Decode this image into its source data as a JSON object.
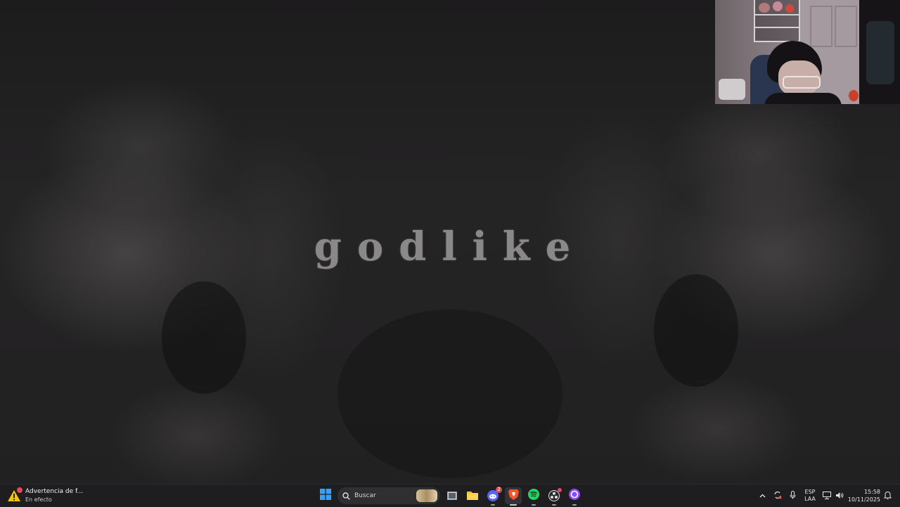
{
  "wallpaper": {
    "title": "godlike"
  },
  "taskbar": {
    "notification": {
      "title": "Advertencia de f...",
      "subtitle": "En efecto",
      "icon": "warning-icon",
      "badge_color": "#e74856"
    },
    "search": {
      "placeholder": "Buscar",
      "icon": "search-icon"
    },
    "apps": [
      {
        "name": "start-button",
        "icon": "windows-icon"
      },
      {
        "name": "task-view",
        "icon": "task-view-icon"
      },
      {
        "name": "file-explorer",
        "icon": "folder-icon"
      },
      {
        "name": "discord",
        "icon": "discord-icon",
        "badge": "2"
      },
      {
        "name": "brave",
        "icon": "brave-icon"
      },
      {
        "name": "spotify",
        "icon": "spotify-icon"
      },
      {
        "name": "obs",
        "icon": "obs-icon"
      },
      {
        "name": "app-purple",
        "icon": "circle-app-icon"
      }
    ],
    "tray": {
      "chevron_icon": "chevron-up-icon",
      "sync_icon": "sync-icon",
      "mic_icon": "microphone-icon",
      "lang_line1": "ESP",
      "lang_line2": "LAA",
      "network_icon": "network-icon",
      "volume_icon": "volume-icon",
      "time": "15:58",
      "date": "10/11/2025",
      "notification_icon": "notification-bell-icon"
    }
  }
}
